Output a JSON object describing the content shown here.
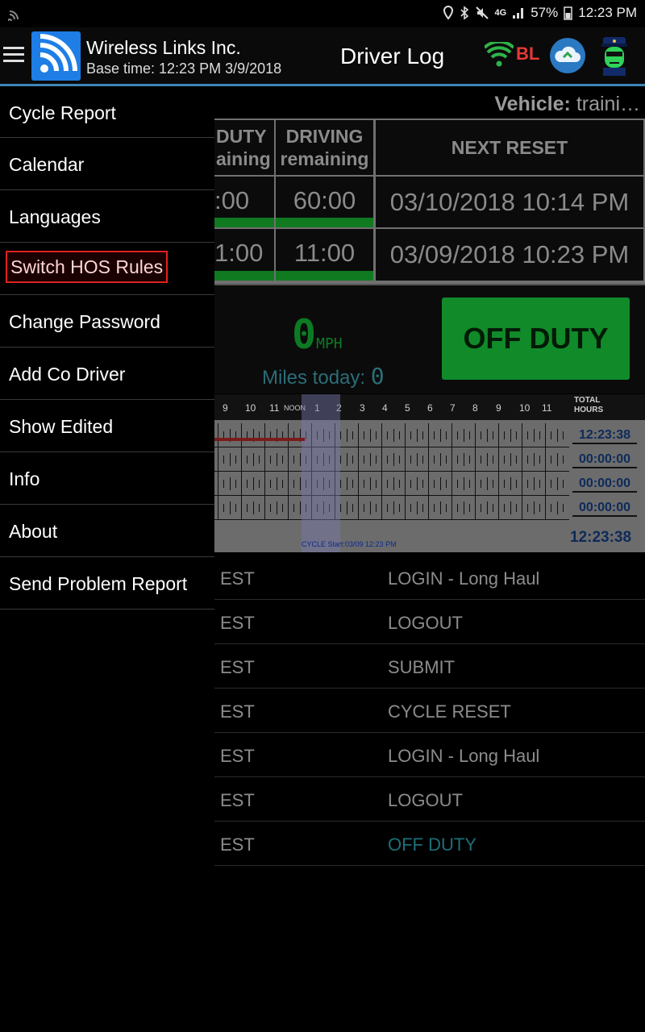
{
  "status_bar": {
    "battery": "57%",
    "network": "4G",
    "time": "12:23 PM"
  },
  "app_bar": {
    "company": "Wireless Links Inc.",
    "base_time": "Base time: 12:23 PM 3/9/2018",
    "title": "Driver Log",
    "bt_status": "BL",
    "icons": [
      "menu-icon",
      "app-logo-icon",
      "wifi-icon",
      "cloud-sync-icon",
      "officer-icon"
    ]
  },
  "vehicle": {
    "label": "Vehicle:",
    "value": "traini…"
  },
  "summary": {
    "headers": [
      "DUTY",
      "aining",
      "DRIVING",
      "remaining",
      "NEXT RESET"
    ],
    "rows": [
      {
        "duty": ":00",
        "driving": "60:00",
        "reset": "03/10/2018 10:14 PM"
      },
      {
        "duty": "1:00",
        "driving": "11:00",
        "reset": "03/09/2018 10:23 PM"
      }
    ]
  },
  "speed": {
    "value": "0",
    "unit": "MPH",
    "miles_label": "Miles today:",
    "miles_value": "0"
  },
  "duty_status_button": "OFF DUTY",
  "log_chart": {
    "hour_labels": [
      "9",
      "10",
      "11",
      "NOON",
      "1",
      "2",
      "3",
      "4",
      "5",
      "6",
      "7",
      "8",
      "9",
      "10",
      "11"
    ],
    "total_label_1": "TOTAL",
    "total_label_2": "HOURS",
    "totals": [
      "12:23:38",
      "00:00:00",
      "00:00:00",
      "00:00:00"
    ],
    "total_sum": "12:23:38",
    "cycle_start": "CYCLE Start:03/09 12:23 PM"
  },
  "events": [
    {
      "tz": "EST",
      "name": "LOGIN - Long Haul",
      "off": false
    },
    {
      "tz": "EST",
      "name": "LOGOUT",
      "off": false
    },
    {
      "tz": "EST",
      "name": "SUBMIT",
      "off": false
    },
    {
      "tz": "EST",
      "name": "CYCLE RESET",
      "off": false
    },
    {
      "tz": "EST",
      "name": "LOGIN - Long Haul",
      "off": false
    },
    {
      "tz": "EST",
      "name": "LOGOUT",
      "off": false
    },
    {
      "tz": "EST",
      "name": "OFF DUTY",
      "off": true
    }
  ],
  "drawer": {
    "items": [
      {
        "label": "Cycle Report"
      },
      {
        "label": "Calendar"
      },
      {
        "label": "Languages"
      },
      {
        "label": "Switch HOS Rules",
        "selected": true
      },
      {
        "label": "Change Password"
      },
      {
        "label": "Add Co Driver"
      },
      {
        "label": "Show Edited"
      },
      {
        "label": "Info"
      },
      {
        "label": "About"
      },
      {
        "label": "Send Problem Report"
      }
    ]
  },
  "colors": {
    "accent_line": "#3f86b8",
    "logo_blue": "#1e7ee6",
    "off_duty_green": "#118a2a",
    "selected_border": "#e0221f",
    "bl_red": "#e53935"
  }
}
